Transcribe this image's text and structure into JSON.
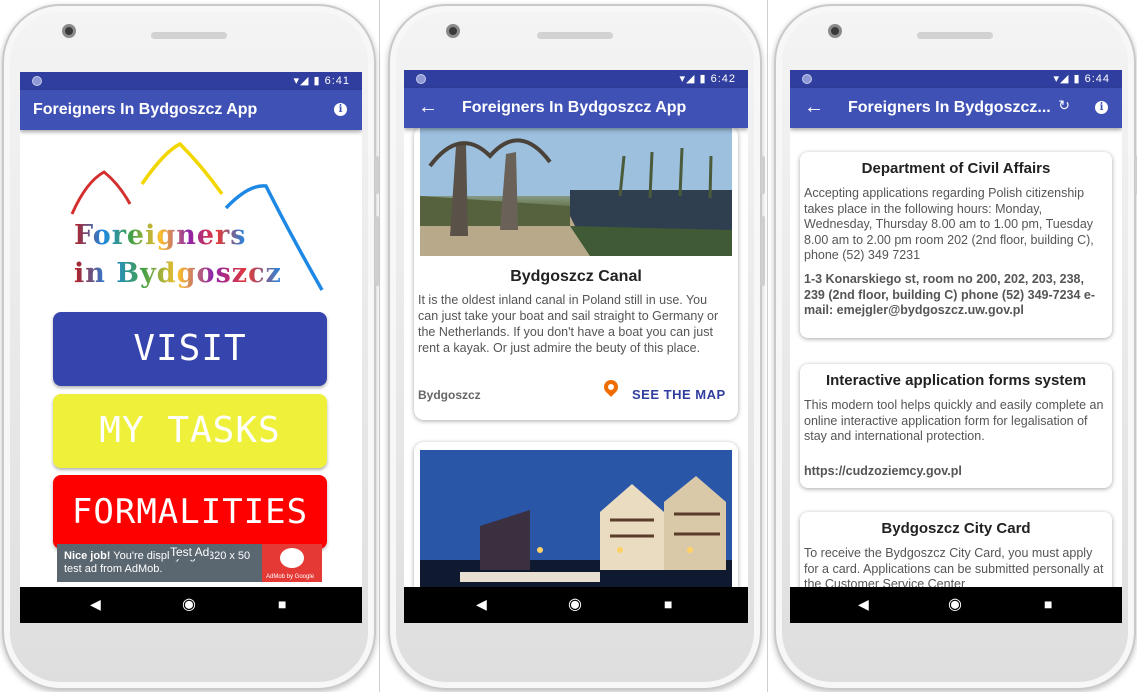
{
  "status": {
    "p1_time": "6:41",
    "p2_time": "6:42",
    "p3_time": "6:44",
    "icons": "▾◢ ▮"
  },
  "home": {
    "app_title": "Foreigners In Bydgoszcz App",
    "logo_line1": "Foreigners",
    "logo_line2": "in Bydgoszcz",
    "buttons": [
      {
        "label": "VISIT",
        "bg": "#3545ad",
        "fg": "#ffffff"
      },
      {
        "label": "MY TASKS",
        "bg": "#eef03a",
        "fg": "#ffffff"
      },
      {
        "label": "FORMALITIES",
        "bg": "#ff0000",
        "fg": "#ffffff"
      }
    ],
    "ad": {
      "bold": "Nice job!",
      "text": " You're displaying a 320 x 50 test ad from AdMob.",
      "label": "Test Ad",
      "brand": "AdMob by Google"
    }
  },
  "visit": {
    "app_title": "Foreigners In Bydgoszcz App",
    "card": {
      "title": "Bydgoszcz Canal",
      "body": "It is the oldest inland canal in Poland still in use. You can just take your boat and sail straight to Germany or the Netherlands. If you don't have a boat you can just rent a kayak. Or just admire the beuty of this place.",
      "location": "Bydgoszcz",
      "map_link": "SEE THE MAP"
    }
  },
  "formalities": {
    "app_title": "Foreigners In Bydgoszcz...",
    "cards": [
      {
        "title": "Department of Civil Affairs",
        "body": "Accepting applications regarding Polish citizenship takes place in the following hours: Monday, Wednesday, Thursday 8.00 am to 1.00 pm, Tuesday 8.00 am to 2.00 pm room 202 (2nd floor, building C), phone (52) 349 7231",
        "bold": "1-3 Konarskiego st, room no 200, 202, 203, 238, 239 (2nd floor, building C) phone (52) 349-7234 e-mail: emejgler@bydgoszcz.uw.gov.pl"
      },
      {
        "title": "Interactive application forms system",
        "body": "This modern tool helps quickly and easily complete an online interactive application form for legalisation of stay and international protection.",
        "bold": "https://cudzoziemcy.gov.pl"
      },
      {
        "title": "Bydgoszcz City Card",
        "body": "To receive the Bydgoszcz City Card, you must apply for a card. Applications can be submitted personally at the Customer Service Center"
      }
    ]
  }
}
